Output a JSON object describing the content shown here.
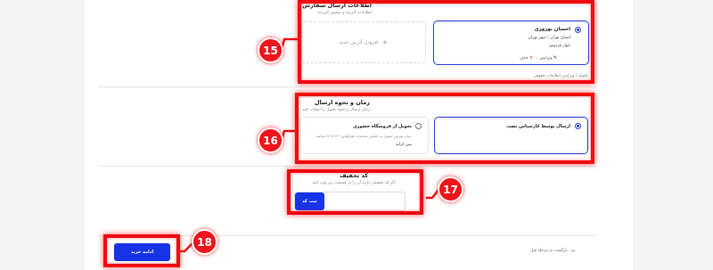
{
  "address_section": {
    "title": "اطلاعات ارسال سفارش",
    "subtitle": "اطلاعات گیرنده و شخص گیرنده",
    "add_address_label": "افزودن آدرس جدید",
    "add_icon": "plus-icon",
    "address_card": {
      "name": "احسان نوروزی",
      "line1": "استان تهران / شهر تهران",
      "line2": "بلوار فردوس",
      "edit_label": "ویرایش",
      "delete_label": "حذف",
      "edit_icon": "pencil-icon",
      "delete_icon": "close-icon"
    },
    "complete_info_link": "تکمیل / ویرایش اطلاعات حقوقی"
  },
  "delivery_section": {
    "title": "زمان و نحوه ارسال",
    "subtitle": "زمان ارسال و نحوه تحویل را انتخاب کنید",
    "options": [
      {
        "label": "ارسال توسط کارشناس نصب",
        "selected": true
      },
      {
        "label": "تحویل از فروشگاه حضوری",
        "note": "زمان تقریبی تحویل بر اساس محدوده جغرافیایی: ۲۴ تا ۴۸ ساعت",
        "extra": "پس کرایه",
        "selected": false
      }
    ]
  },
  "discount_section": {
    "title": "کد تخفیف",
    "subtitle": "اگر کد تخفیفی دارید آن را در قسمت زیر وارد کنید",
    "input_value": "",
    "apply_label": "ثبت کد"
  },
  "footer": {
    "back_label": "بازگشت به مرحله قبل",
    "back_icon": "arrow-right-icon",
    "continue_label": "ادامه خرید"
  },
  "annotations": [
    "15",
    "16",
    "17",
    "18"
  ],
  "colors": {
    "accent": "#1733e6",
    "highlight": "#ee0a12",
    "background": "#f4f4f5"
  }
}
